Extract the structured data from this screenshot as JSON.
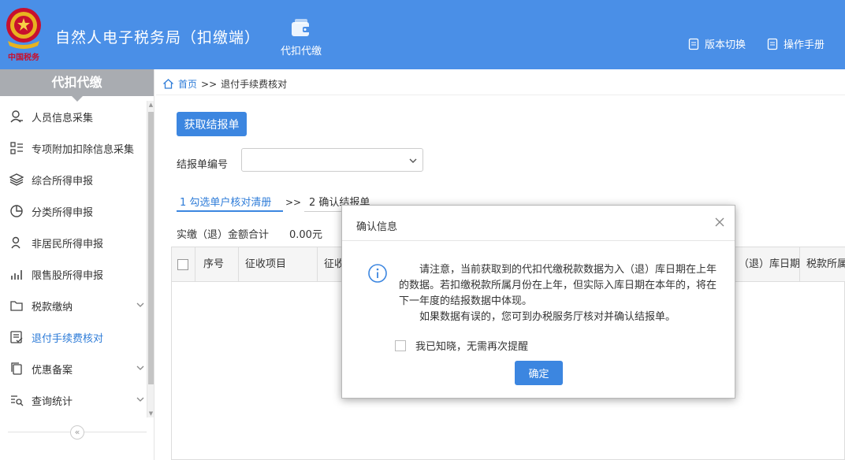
{
  "header": {
    "title": "自然人电子税务局（扣缴端）",
    "logo_text": "中国税务",
    "nav_tile": "代扣代缴",
    "links": [
      "版本切换",
      "操作手册"
    ]
  },
  "sidebar": {
    "heading": "代扣代缴",
    "items": [
      {
        "label": "人员信息采集",
        "icon": "person-icon"
      },
      {
        "label": "专项附加扣除信息采集",
        "icon": "list-icon"
      },
      {
        "label": "综合所得申报",
        "icon": "layers-icon"
      },
      {
        "label": "分类所得申报",
        "icon": "pie-chart-icon"
      },
      {
        "label": "非居民所得申报",
        "icon": "user-icon"
      },
      {
        "label": "限售股所得申报",
        "icon": "bar-chart-icon"
      },
      {
        "label": "税款缴纳",
        "icon": "folder-icon"
      },
      {
        "label": "退付手续费核对",
        "icon": "check-doc-icon"
      },
      {
        "label": "优惠备案",
        "icon": "copy-icon"
      },
      {
        "label": "查询统计",
        "icon": "search-list-icon"
      }
    ],
    "collapse_glyph": "«"
  },
  "breadcrumb": {
    "home": "首页",
    "sep": ">>",
    "current": "退付手续费核对"
  },
  "main": {
    "fetch_button": "获取结报单",
    "form_label": "结报单编号",
    "step1": "1 勾选单户核对清册",
    "step_sep": ">>",
    "step2": "2 确认结报单",
    "total_label": "实缴（退）金额合计",
    "total_value": "0.00元",
    "columns": [
      "序号",
      "征收项目",
      "征收",
      "（退）库日期",
      "税款所属"
    ]
  },
  "dialog": {
    "title": "确认信息",
    "message_1": "请注意，当前获取到的代扣代缴税款数据为入（退）库日期在上年的数据。若扣缴税款所属月份在上年，但实际入库日期在本年的，将在下一年度的结报数据中体现。",
    "message_2": "如果数据有误的，您可到办税服务厅核对并确认结报单。",
    "checkbox_label": "我已知晓，无需再次提醒",
    "ok_button": "确定"
  },
  "colors": {
    "primary": "#3c86e0",
    "header_bg": "#4a8fe7",
    "sidebar_head": "#a9acb1",
    "active": "#2e7cd8"
  }
}
